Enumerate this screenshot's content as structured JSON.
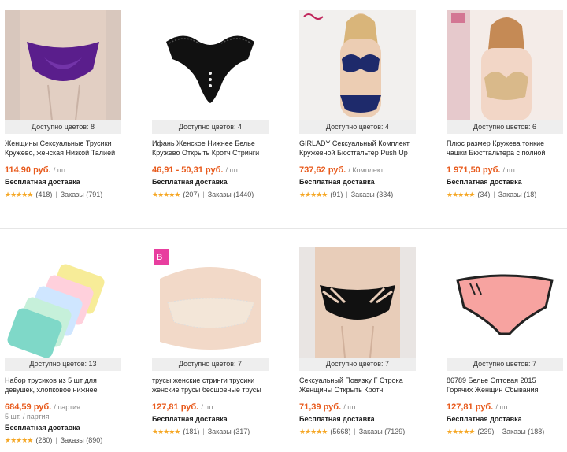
{
  "products": [
    {
      "colors": "Доступно цветов: 8",
      "title": "Женщины Сексуальные Трусики Кружево, женская Низкой Талией",
      "price": "114,90 руб.",
      "unit": "/ шт.",
      "lot": "",
      "shipping": "Бесплатная доставка",
      "reviews": "(418)",
      "orders": "Заказы (791)",
      "image": "purple-panties-image",
      "accent": "#5a1e8c"
    },
    {
      "colors": "Доступно цветов: 4",
      "title": "Ифань Женское Нижнее Белье Кружево Открыть Кротч Стринги",
      "price": "46,91 - 50,31 руб.",
      "unit": "/ шт.",
      "lot": "",
      "shipping": "Бесплатная доставка",
      "reviews": "(207)",
      "orders": "Заказы (1440)",
      "image": "black-lace-thong-image",
      "accent": "#111111"
    },
    {
      "colors": "Доступно цветов: 4",
      "title": "GIRLADY Сексуальный Комплект Кружевной Бюстгальтер Push Up",
      "price": "737,62 руб.",
      "unit": "/ Комплект",
      "lot": "",
      "shipping": "Бесплатная доставка",
      "reviews": "(91)",
      "orders": "Заказы (334)",
      "image": "navy-lace-set-image",
      "accent": "#1e2a6b",
      "brand": "girlady"
    },
    {
      "colors": "Доступно цветов: 6",
      "title": "Плюс размер Кружева тонкие чашки Бюстгальтера с полной",
      "price": "1 971,50 руб.",
      "unit": "/ шт.",
      "lot": "",
      "shipping": "Бесплатная доставка",
      "reviews": "(34)",
      "orders": "Заказы (18)",
      "image": "beige-bra-image",
      "accent": "#d9b98a"
    },
    {
      "colors": "Доступно цветов: 13",
      "title": "Набор трусиков из 5 шт для девушек, хлопковое нижнее",
      "price": "684,59 руб.",
      "unit": "/ партия",
      "lot": "5 шт. / партия",
      "shipping": "Бесплатная доставка",
      "reviews": "(280)",
      "orders": "Заказы (890)",
      "image": "cotton-panties-set-image",
      "accent": "#7fd8c8"
    },
    {
      "colors": "Доступно цветов: 7",
      "title": "трусы женские стринги трусики женские трусы бесшовные трусы",
      "price": "127,81 руб.",
      "unit": "/ шт.",
      "lot": "",
      "shipping": "Бесплатная доставка",
      "reviews": "(181)",
      "orders": "Заказы (317)",
      "image": "white-lace-thong-image",
      "accent": "#f3e6d8"
    },
    {
      "colors": "Доступно цветов: 7",
      "title": "Сексуальный Повязку Г Строка Женщины Открыть Кротч",
      "price": "71,39 руб.",
      "unit": "/ шт.",
      "lot": "",
      "shipping": "Бесплатная доставка",
      "reviews": "(5668)",
      "orders": "Заказы (7139)",
      "image": "black-strappy-panties-image",
      "accent": "#111111"
    },
    {
      "colors": "Доступно цветов: 7",
      "title": "86789 Белье Оптовая 2015 Горячих Женщин Сбывания",
      "price": "127,81 руб.",
      "unit": "/ шт.",
      "lot": "",
      "shipping": "Бесплатная доставка",
      "reviews": "(239)",
      "orders": "Заказы (188)",
      "image": "pink-panties-image",
      "accent": "#f7a3a0"
    }
  ],
  "stars": "★★★★★"
}
